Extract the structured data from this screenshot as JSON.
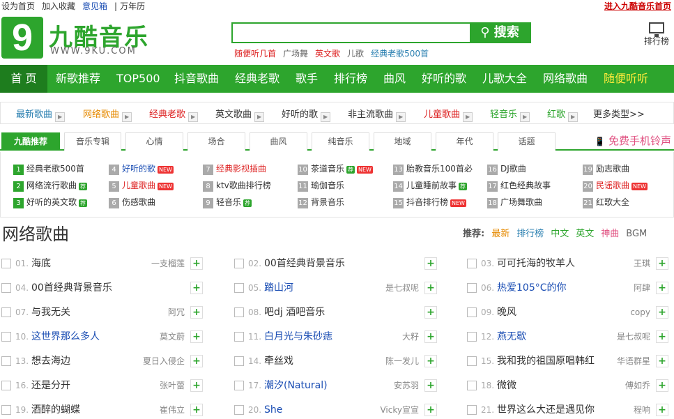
{
  "top": {
    "links": [
      "设为首页",
      "加入收藏",
      "意见箱",
      "万年历"
    ],
    "sep": "|",
    "right": "进入九酷音乐首页"
  },
  "logo": {
    "digit": "9",
    "name": "九酷音乐",
    "url": "WWW.9KU.COM"
  },
  "search": {
    "value": "",
    "button": "搜索",
    "hot": [
      "随便听几首",
      "广场舞",
      "英文歌",
      "儿歌",
      "经典老歌500首"
    ]
  },
  "rank_label": "排行榜",
  "nav": [
    "首 页",
    "新歌推荐",
    "TOP500",
    "抖音歌曲",
    "经典老歌",
    "歌手",
    "排行榜",
    "曲风",
    "好听的歌",
    "儿歌大全",
    "网络歌曲",
    "随便听听"
  ],
  "cats": [
    "最新歌曲",
    "网络歌曲",
    "经典老歌",
    "英文歌曲",
    "好听的歌",
    "非主流歌曲",
    "儿童歌曲",
    "轻音乐",
    "红歌",
    "更多类型>>"
  ],
  "tabs": [
    "九酷推荐",
    "音乐专辑",
    "心情",
    "场合",
    "曲风",
    "纯音乐",
    "地域",
    "年代",
    "话题"
  ],
  "ring": "免费手机铃声",
  "grid": [
    [
      "1",
      "经典老歌500首",
      ""
    ],
    [
      "4",
      "好听的歌",
      "new"
    ],
    [
      "7",
      "经典影视插曲",
      ""
    ],
    [
      "10",
      "茶道音乐",
      "tj new"
    ],
    [
      "13",
      "胎教音乐100首必",
      ""
    ],
    [
      "16",
      "DJ歌曲",
      ""
    ],
    [
      "19",
      "励志歌曲",
      ""
    ],
    [
      "2",
      "网络流行歌曲",
      "tj"
    ],
    [
      "5",
      "儿童歌曲",
      "new"
    ],
    [
      "8",
      "ktv歌曲排行榜",
      ""
    ],
    [
      "11",
      "瑜伽音乐",
      ""
    ],
    [
      "14",
      "儿童睡前故事",
      "tj"
    ],
    [
      "17",
      "红色经典故事",
      ""
    ],
    [
      "20",
      "民谣歌曲",
      "new"
    ],
    [
      "3",
      "好听的英文歌",
      "tj"
    ],
    [
      "6",
      "伤感歌曲",
      ""
    ],
    [
      "9",
      "轻音乐",
      "tj"
    ],
    [
      "12",
      "背景音乐",
      ""
    ],
    [
      "15",
      "抖音排行榜",
      "new"
    ],
    [
      "18",
      "广场舞歌曲",
      ""
    ],
    [
      "21",
      "红歌大全",
      ""
    ]
  ],
  "tag_tj": "荐",
  "tag_new": "NEW",
  "section": {
    "title": "网络歌曲",
    "rec_label": "推荐:",
    "rec": [
      "最新",
      "排行榜",
      "中文",
      "英文",
      "神曲",
      "BGM"
    ]
  },
  "songs": [
    [
      "01.",
      "海底",
      "一支榴莲"
    ],
    [
      "02.",
      "00首经典背景音乐",
      ""
    ],
    [
      "03.",
      "可可托海的牧羊人",
      "王琪"
    ],
    [
      "04.",
      "00首经典背景音乐",
      ""
    ],
    [
      "05.",
      "踏山河",
      "是七叔呢"
    ],
    [
      "06.",
      "热爱105°C的你",
      "阿肆"
    ],
    [
      "07.",
      "与我无关",
      "阿冗"
    ],
    [
      "08.",
      "吧dj 酒吧音乐",
      ""
    ],
    [
      "09.",
      "晚风",
      "copy"
    ],
    [
      "10.",
      "这世界那么多人",
      "莫文蔚"
    ],
    [
      "11.",
      "白月光与朱砂痣",
      "大籽"
    ],
    [
      "12.",
      "燕无歇",
      "是七叔呢"
    ],
    [
      "13.",
      "想去海边",
      "夏日入侵企"
    ],
    [
      "14.",
      "牵丝戏",
      "陈一发儿"
    ],
    [
      "15.",
      "我和我的祖国原唱韩红",
      "华语群星"
    ],
    [
      "16.",
      "还是分开",
      "张叶蕾"
    ],
    [
      "17.",
      "潮汐(Natural)",
      "安苏羽"
    ],
    [
      "18.",
      "微微",
      "傅如乔"
    ],
    [
      "19.",
      "酒醉的蝴蝶",
      "崔伟立"
    ],
    [
      "20.",
      "She",
      "Vicky宣宣"
    ],
    [
      "21.",
      "世界这么大还是遇见你",
      "程响"
    ]
  ],
  "plus": "+"
}
